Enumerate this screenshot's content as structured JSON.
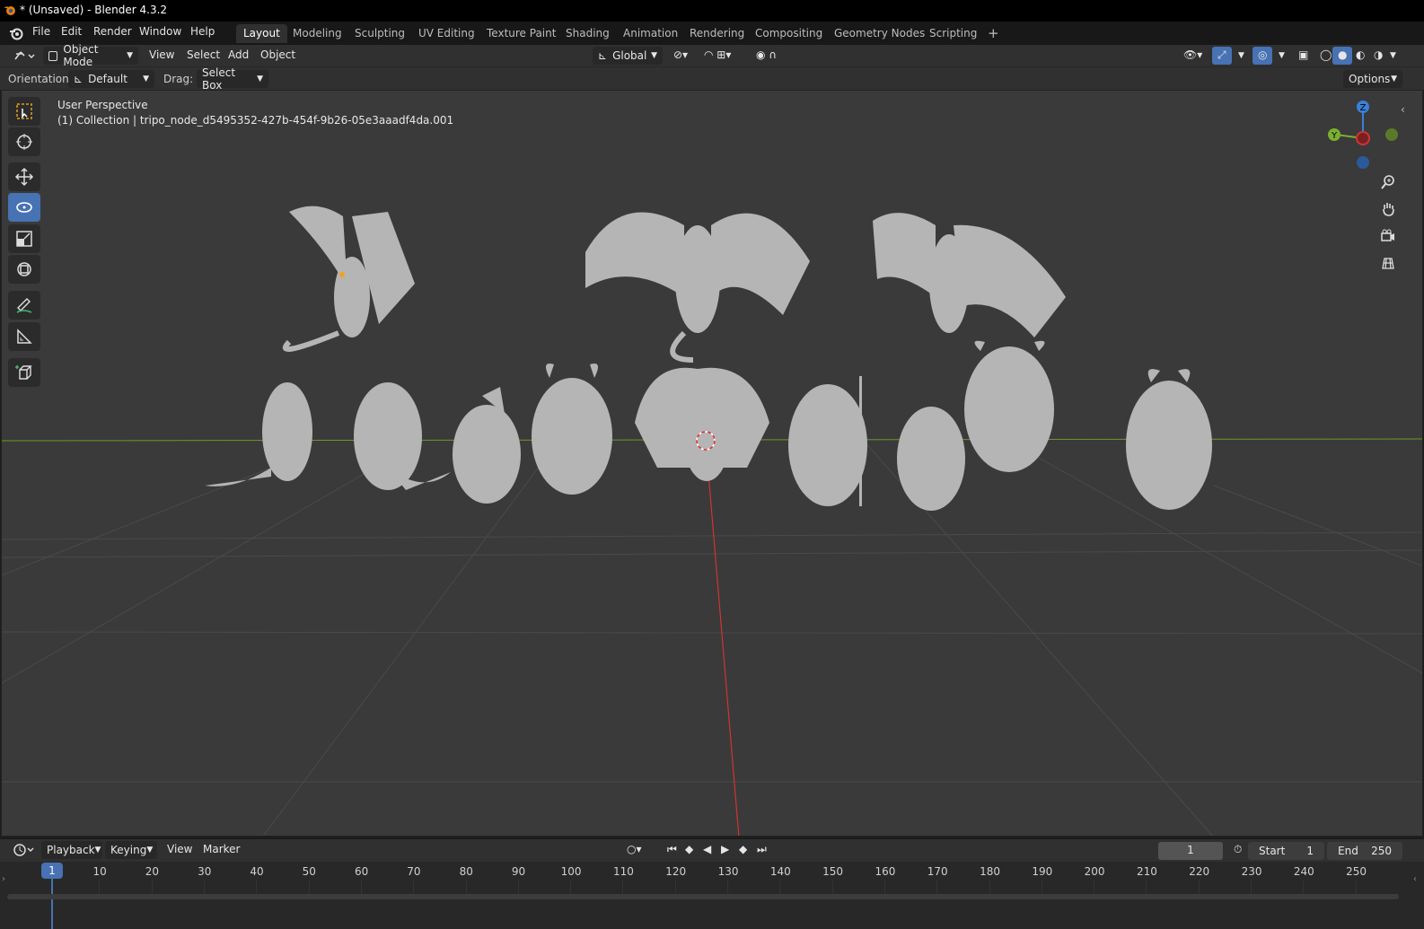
{
  "window": {
    "title": "* (Unsaved) - Blender 4.3.2"
  },
  "menus": [
    "File",
    "Edit",
    "Render",
    "Window",
    "Help"
  ],
  "workspaces": [
    "Layout",
    "Modeling",
    "Sculpting",
    "UV Editing",
    "Texture Paint",
    "Shading",
    "Animation",
    "Rendering",
    "Compositing",
    "Geometry Nodes",
    "Scripting"
  ],
  "active_workspace": "Layout",
  "header": {
    "mode": "Object Mode",
    "menus": [
      "View",
      "Select",
      "Add",
      "Object"
    ],
    "transform_orientation": "Global"
  },
  "tool_settings": {
    "orientation_label": "Orientation:",
    "orientation_value": "Default",
    "drag_label": "Drag:",
    "drag_value": "Select Box",
    "options": "Options"
  },
  "viewport": {
    "perspective": "User Perspective",
    "collection_info": "(1) Collection | tripo_node_d5495352-427b-454f-9b26-05e3aaadf4da.001",
    "gizmo_axes": {
      "z": "Z",
      "y": "Y"
    },
    "colors": {
      "background": "#3a3a3a",
      "x_axis": "#d03434",
      "y_axis": "#6a9a2a",
      "model": "#b5b5b5",
      "active_tool": "#4772b3"
    }
  },
  "tools": [
    "select-box",
    "cursor",
    "move",
    "rotate",
    "scale",
    "transform",
    "annotate",
    "measure",
    "add-cube"
  ],
  "active_tool": "rotate",
  "nav_buttons": [
    "zoom",
    "pan",
    "camera",
    "ortho-grid"
  ],
  "timeline": {
    "menus": [
      "Playback",
      "Keying",
      "View",
      "Marker"
    ],
    "current_frame": "1",
    "start_label": "Start",
    "start_value": "1",
    "end_label": "End",
    "end_value": "250",
    "ruler": [
      "10",
      "20",
      "30",
      "40",
      "50",
      "60",
      "70",
      "80",
      "90",
      "100",
      "110",
      "120",
      "130",
      "140",
      "150",
      "160",
      "170",
      "180",
      "190",
      "200",
      "210",
      "220",
      "230",
      "240",
      "250"
    ]
  }
}
